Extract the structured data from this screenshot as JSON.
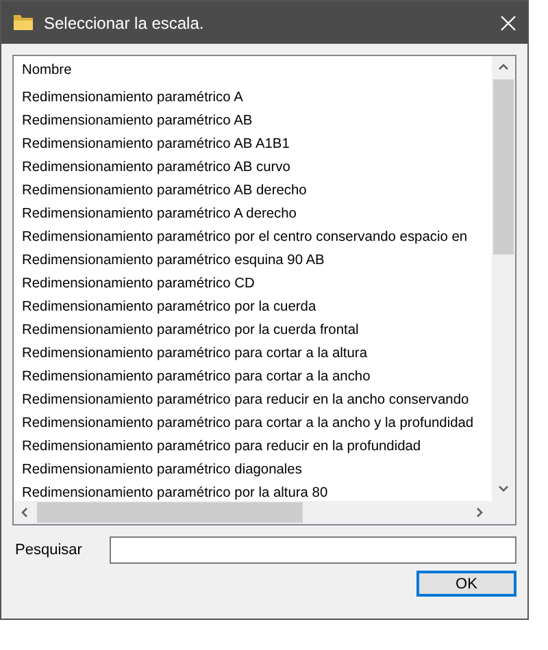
{
  "window": {
    "title": "Seleccionar la escala."
  },
  "list": {
    "header": "Nombre",
    "rows": [
      {
        "name": "Redimensionamiento paramétrico A",
        "selected": false
      },
      {
        "name": "Redimensionamiento paramétrico AB",
        "selected": false
      },
      {
        "name": "Redimensionamiento paramétrico AB A1B1",
        "selected": false
      },
      {
        "name": "Redimensionamiento paramétrico AB curvo",
        "selected": false
      },
      {
        "name": "Redimensionamiento paramétrico AB derecho",
        "selected": false
      },
      {
        "name": "Redimensionamiento paramétrico A derecho",
        "selected": false
      },
      {
        "name": "Redimensionamiento paramétrico por el centro conservando espacio en",
        "selected": false
      },
      {
        "name": "Redimensionamiento paramétrico esquina 90 AB",
        "selected": false
      },
      {
        "name": "Redimensionamiento paramétrico CD",
        "selected": false
      },
      {
        "name": "Redimensionamiento paramétrico por la cuerda",
        "selected": false
      },
      {
        "name": "Redimensionamiento paramétrico por la cuerda frontal",
        "selected": false
      },
      {
        "name": "Redimensionamiento paramétrico para cortar a la altura",
        "selected": false
      },
      {
        "name": "Redimensionamiento paramétrico para cortar a la ancho",
        "selected": false
      },
      {
        "name": "Redimensionamiento paramétrico para reducir en la ancho conservando",
        "selected": false
      },
      {
        "name": "Redimensionamiento paramétrico para cortar a la ancho y la profundidad",
        "selected": false
      },
      {
        "name": "Redimensionamiento paramétrico para reducir en la profundidad",
        "selected": false
      },
      {
        "name": "Redimensionamiento paramétrico diagonales",
        "selected": false
      },
      {
        "name": "Redimensionamiento paramétrico por la altura 80",
        "selected": false
      }
    ]
  },
  "search": {
    "label": "Pesquisar"
  },
  "buttons": [
    {
      "label": "OK"
    }
  ]
}
